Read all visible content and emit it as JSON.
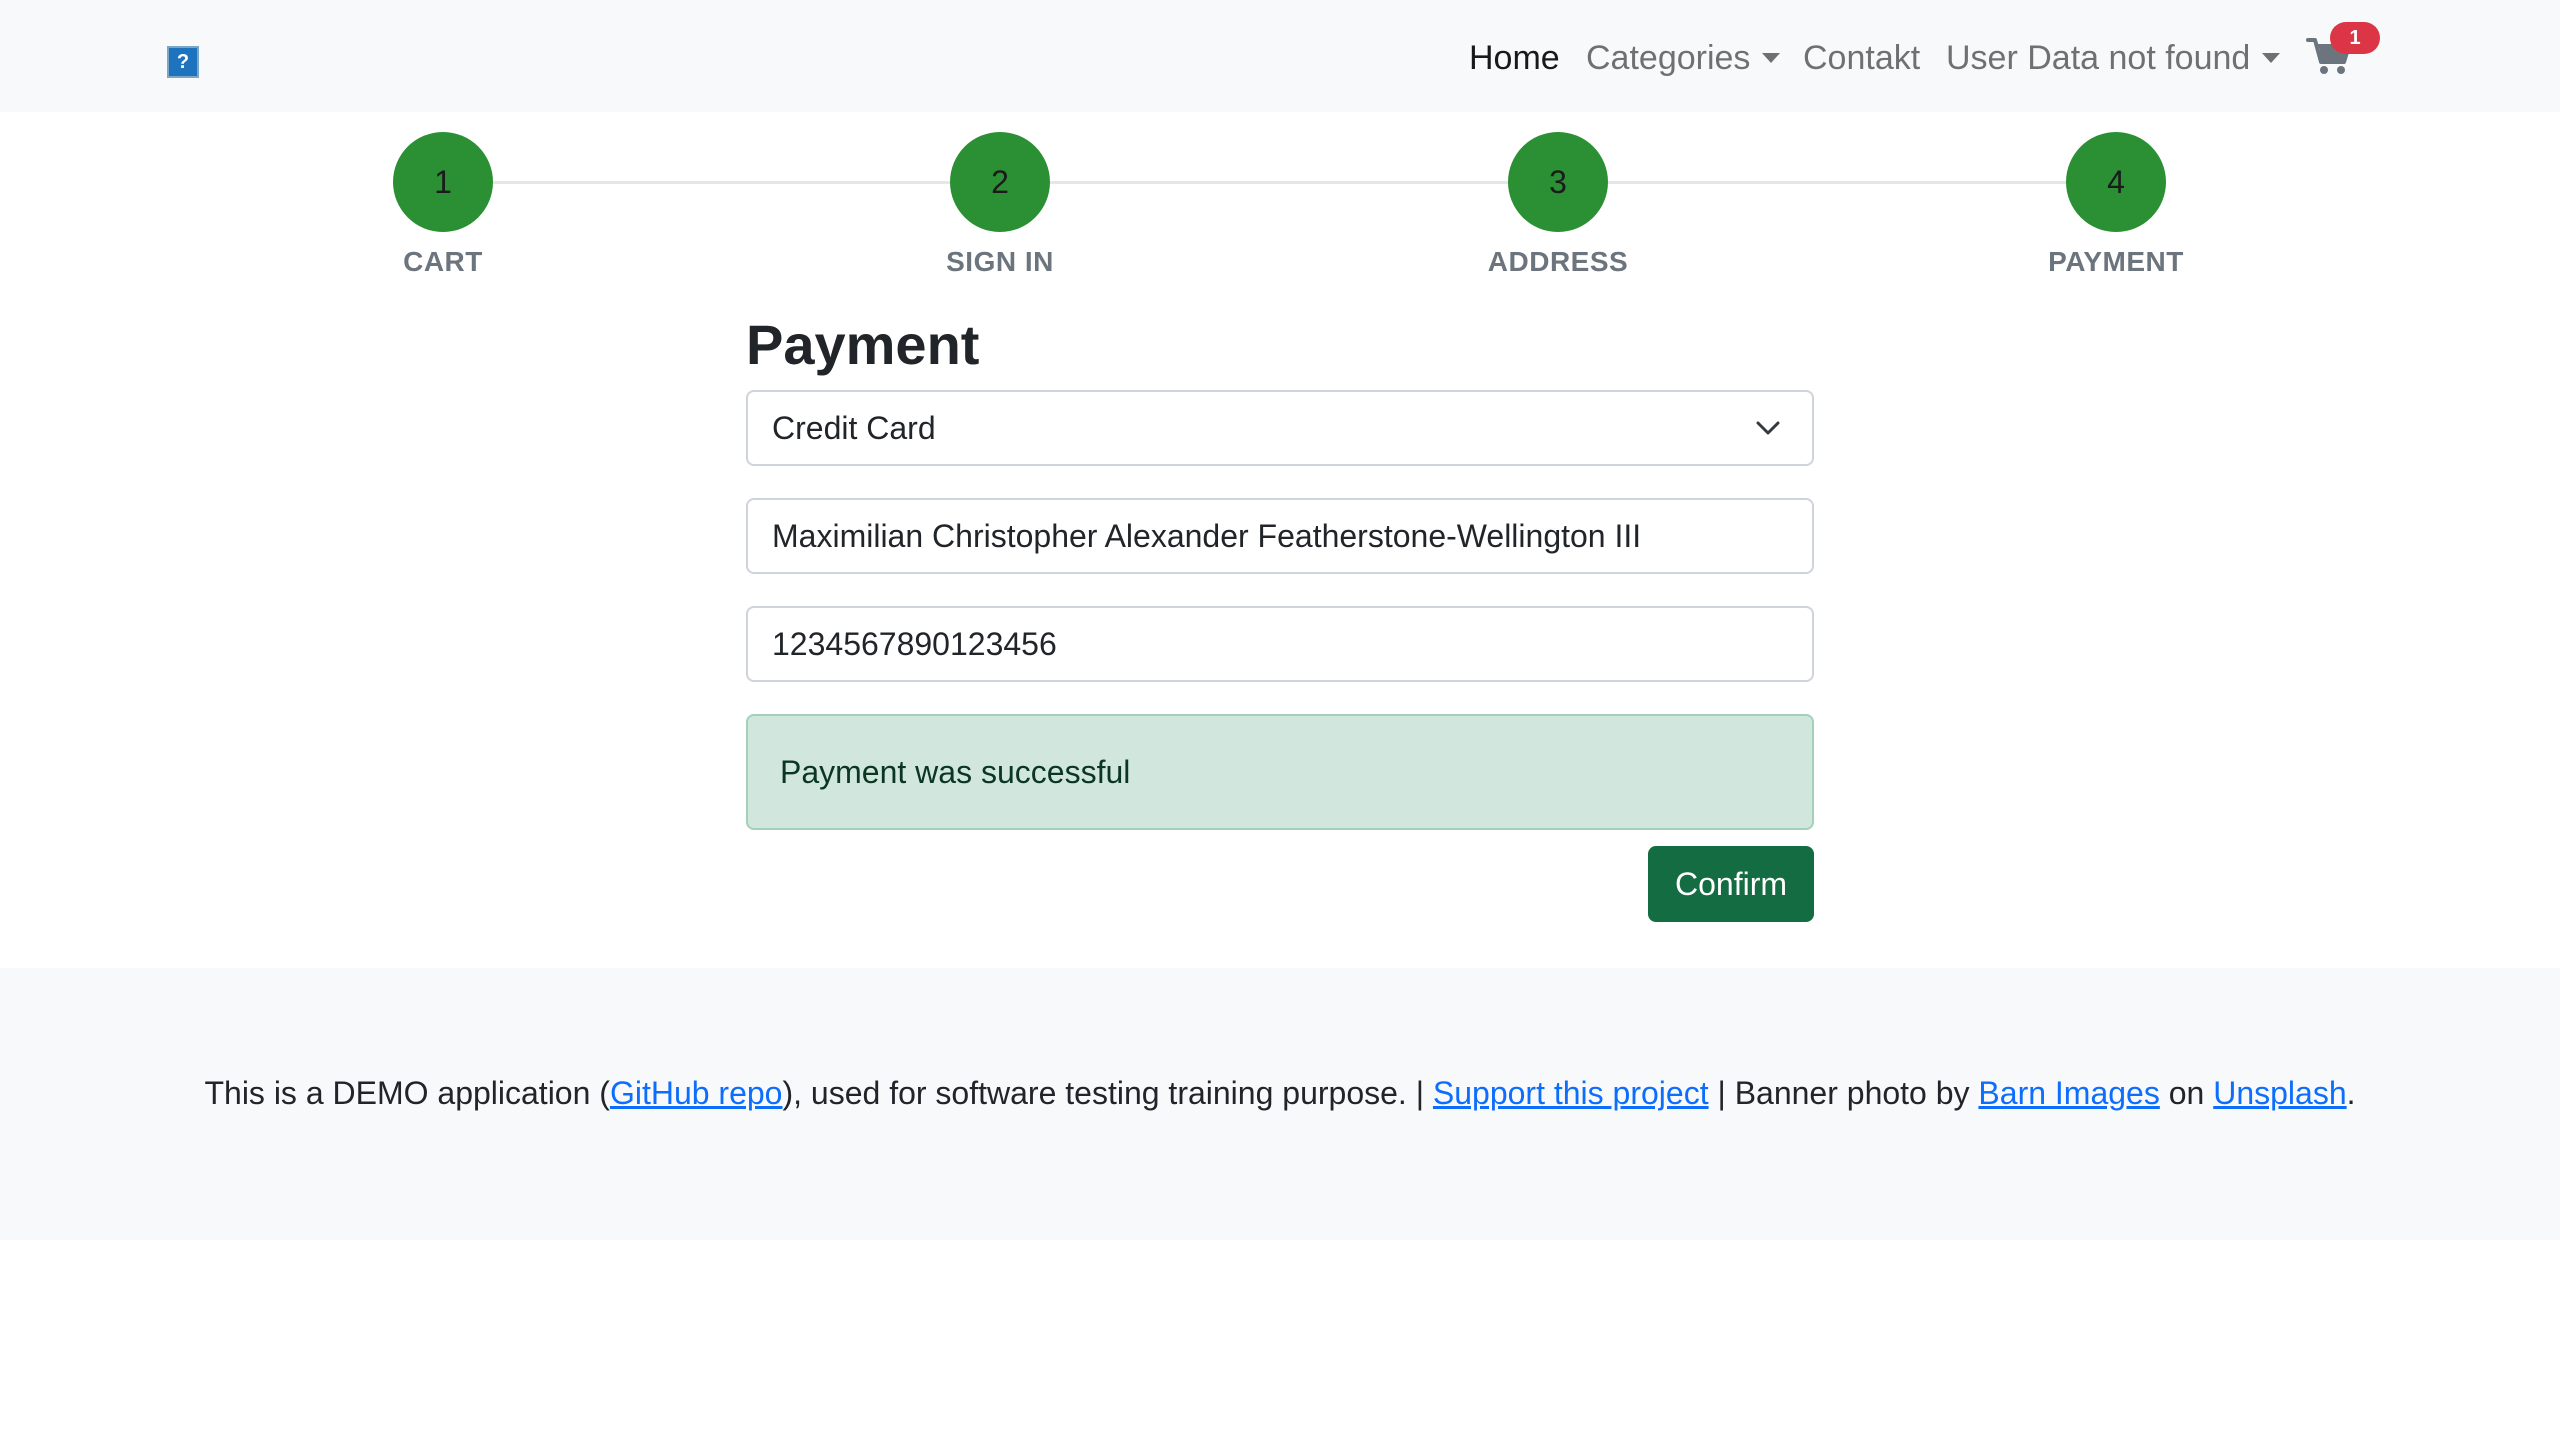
{
  "navbar": {
    "logo_glyph": "?",
    "links": {
      "home": "Home",
      "categories": "Categories",
      "contact": "Contakt",
      "user": "User Data not found"
    },
    "cart_count": "1"
  },
  "stepper": {
    "steps": [
      {
        "number": "1",
        "label": "CART"
      },
      {
        "number": "2",
        "label": "SIGN IN"
      },
      {
        "number": "3",
        "label": "ADDRESS"
      },
      {
        "number": "4",
        "label": "PAYMENT"
      }
    ],
    "completed_color": "#2a9033"
  },
  "payment": {
    "heading": "Payment",
    "method_selected": "Credit Card",
    "cardholder_name": "Maximilian Christopher Alexander Featherstone-Wellington III",
    "card_number": "1234567890123456",
    "alert_text": "Payment was successful",
    "confirm_label": "Confirm"
  },
  "footer": {
    "text_1": "This is a DEMO application (",
    "link_github": "GitHub repo",
    "text_2": "), used for software testing training purpose. | ",
    "link_support": "Support this project",
    "text_3": " | Banner photo by ",
    "link_barn": "Barn Images",
    "text_4": " on ",
    "link_unsplash": "Unsplash",
    "text_5": "."
  },
  "colors": {
    "accent_green": "#146c43",
    "alert_bg": "#d1e7dd",
    "badge_red": "#dc3545",
    "link_blue": "#0d6efd"
  }
}
